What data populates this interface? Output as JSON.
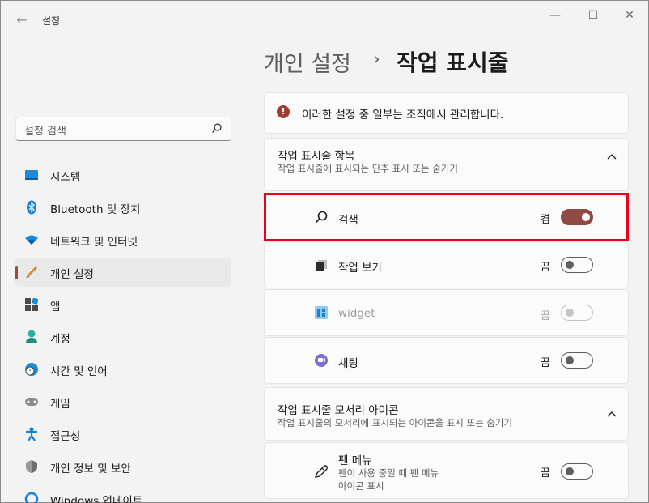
{
  "window": {
    "title": "설정",
    "controls": {
      "minimize": "—",
      "maximize": "☐",
      "close": "✕"
    }
  },
  "search": {
    "placeholder": "설정 검색"
  },
  "nav": {
    "items": [
      {
        "label": "시스템",
        "icon": "monitor-icon"
      },
      {
        "label": "Bluetooth 및 장치",
        "icon": "bluetooth-icon"
      },
      {
        "label": "네트워크 및 인터넷",
        "icon": "wifi-icon"
      },
      {
        "label": "개인 설정",
        "icon": "brush-icon",
        "selected": true
      },
      {
        "label": "앱",
        "icon": "apps-icon"
      },
      {
        "label": "계정",
        "icon": "person-icon"
      },
      {
        "label": "시간 및 언어",
        "icon": "clock-globe-icon"
      },
      {
        "label": "게임",
        "icon": "gamepad-icon"
      },
      {
        "label": "접근성",
        "icon": "accessibility-icon"
      },
      {
        "label": "개인 정보 및 보안",
        "icon": "shield-icon"
      },
      {
        "label": "Windows 업데이트",
        "icon": "update-icon"
      }
    ]
  },
  "breadcrumb": {
    "parent": "개인 설정",
    "separator": "›",
    "current": "작업 표시줄"
  },
  "notice": {
    "text": "이러한 설정 중 일부는 조직에서 관리합니다.",
    "icon": "info-icon"
  },
  "taskbar_items": {
    "title": "작업 표시줄 항목",
    "subtitle": "작업 표시줄에 표시되는 단추 표시 또는 숨기기",
    "rows": [
      {
        "label": "검색",
        "state": "켬",
        "on": true,
        "icon": "search-icon"
      },
      {
        "label": "작업 보기",
        "state": "끔",
        "on": false,
        "icon": "task-view-icon"
      },
      {
        "label": "widget",
        "state": "끔",
        "on": false,
        "disabled": true,
        "icon": "widgets-icon"
      },
      {
        "label": "채팅",
        "state": "끔",
        "on": false,
        "icon": "chat-icon"
      }
    ]
  },
  "corner_icons": {
    "title": "작업 표시줄 모서리 아이콘",
    "subtitle": "작업 표시줄의 모서리에 표시되는 아이콘을 표시 또는 숨기기",
    "rows": [
      {
        "label": "펜 메뉴",
        "desc1": "펜이 사용 중일 때 펜 메뉴",
        "desc2": "아이콘 표시",
        "state": "끔",
        "on": false,
        "icon": "pen-icon"
      }
    ]
  },
  "colors": {
    "accent": "#8f4a44",
    "highlight": "#e8001c",
    "info": "#a23b35"
  }
}
